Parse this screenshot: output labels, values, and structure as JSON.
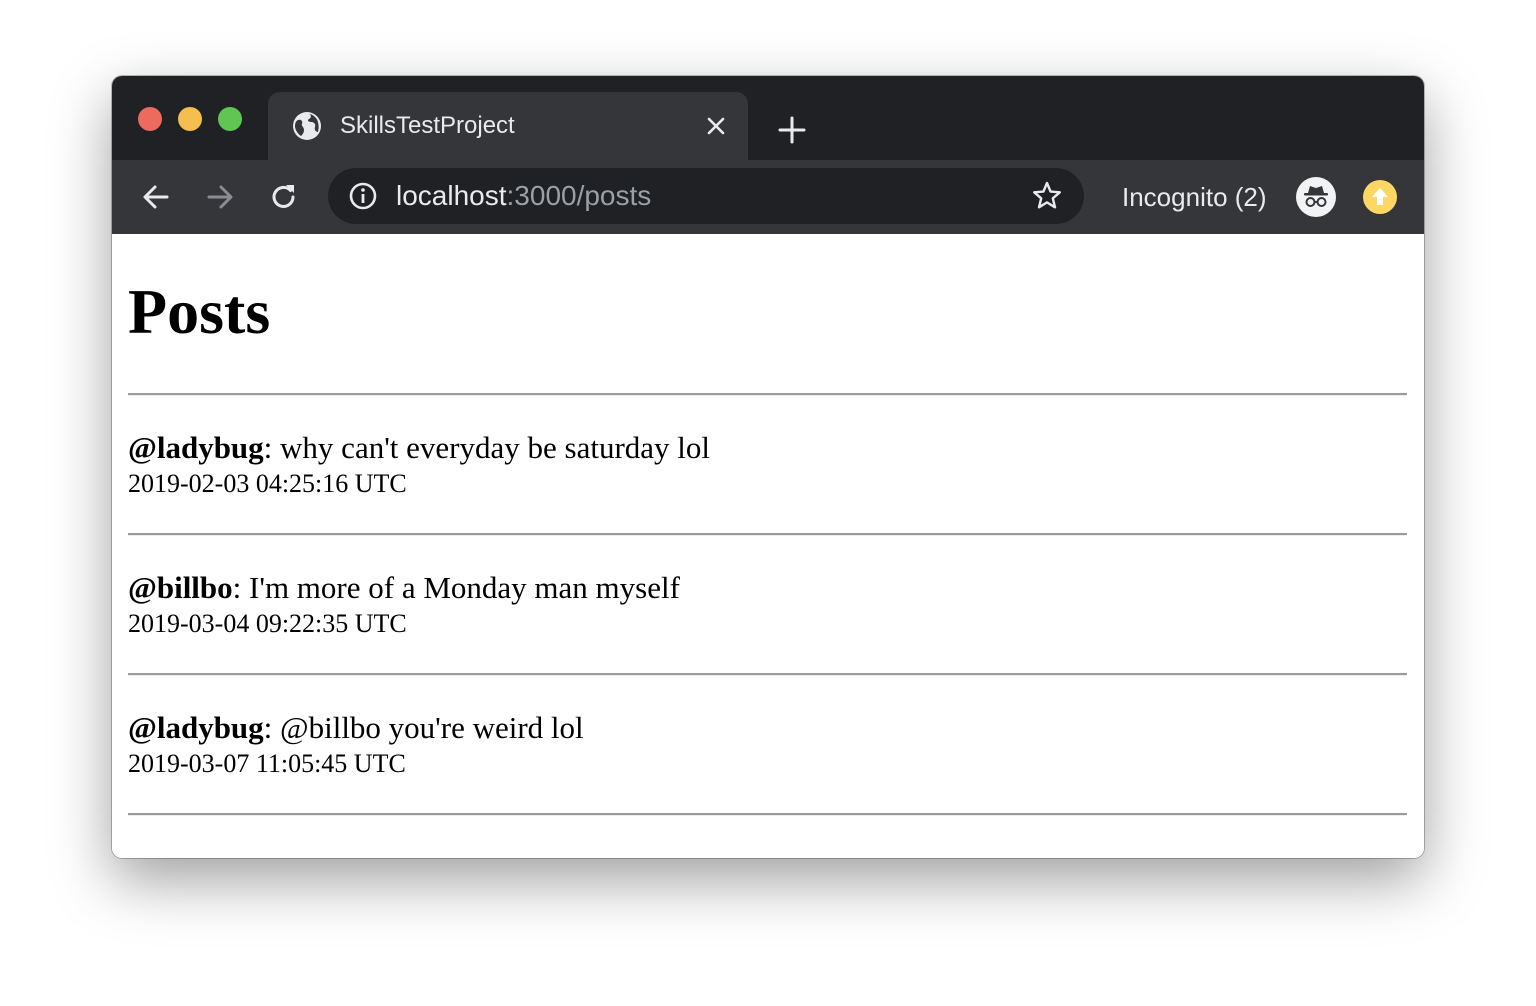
{
  "browser": {
    "tab": {
      "title": "SkillsTestProject",
      "favicon": "globe-icon",
      "close_icon": "close-icon"
    },
    "new_tab_icon": "plus-icon",
    "toolbar": {
      "back_icon": "arrow-left-icon",
      "forward_icon": "arrow-right-icon",
      "reload_icon": "reload-icon",
      "url_host": "localhost",
      "url_path": ":3000/posts",
      "info_icon": "info-icon",
      "bookmark_icon": "star-icon",
      "incognito_label": "Incognito (2)",
      "incognito_icon": "incognito-icon",
      "update_icon": "update-arrow-icon"
    },
    "colors": {
      "frame": "#202124",
      "toolbar": "#35363a",
      "text": "#e8eaed",
      "url_path": "#9aa0a6",
      "close_dot": "#ed6a5e",
      "minimize_dot": "#f5bf4f",
      "zoom_dot": "#61c554",
      "update_badge": "#fdd663"
    }
  },
  "page": {
    "title": "Posts",
    "posts": [
      {
        "author": "@ladybug",
        "separator": ": ",
        "text": "why can't everyday be saturday lol",
        "timestamp": "2019-02-03 04:25:16 UTC"
      },
      {
        "author": "@billbo",
        "separator": ": ",
        "text": "I'm more of a Monday man myself",
        "timestamp": "2019-03-04 09:22:35 UTC"
      },
      {
        "author": "@ladybug",
        "separator": ": ",
        "text": "@billbo you're weird lol",
        "timestamp": "2019-03-07 11:05:45 UTC"
      }
    ]
  }
}
